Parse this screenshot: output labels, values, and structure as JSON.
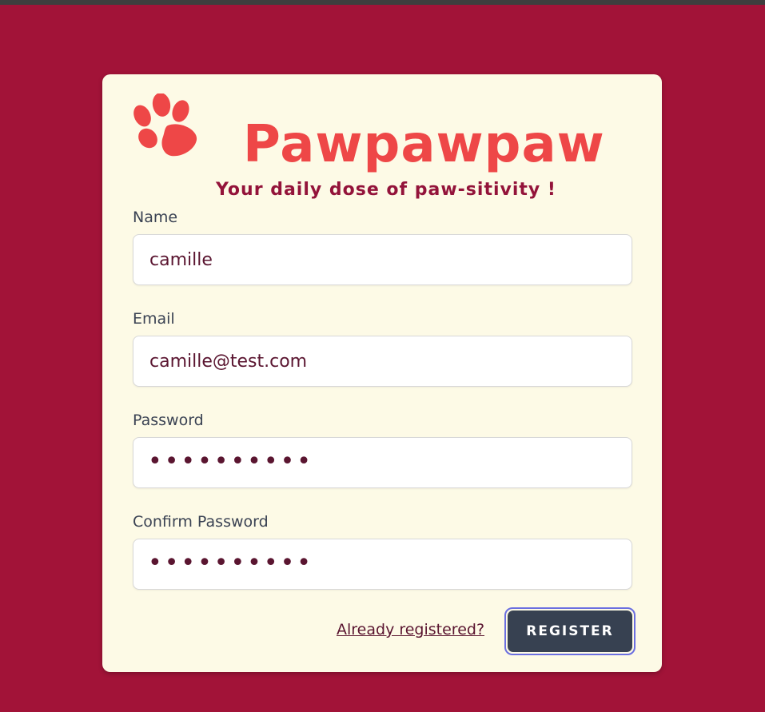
{
  "brand": {
    "name": "Pawpawpaw",
    "tagline": "Your daily dose of paw-sitivity !",
    "logo_color": "#ee4747",
    "tagline_color": "#93133a"
  },
  "form": {
    "name_label": "Name",
    "name_value": "camille",
    "email_label": "Email",
    "email_value": "camille@test.com",
    "password_label": "Password",
    "password_masked": "••••••••••",
    "confirm_label": "Confirm Password",
    "confirm_masked": "••••••••••"
  },
  "actions": {
    "login_link": "Already registered?",
    "register_button": "REGISTER"
  },
  "colors": {
    "background": "#a21338",
    "card": "#fdfae6",
    "button": "#374151",
    "focus_ring": "#6b6fe0"
  }
}
